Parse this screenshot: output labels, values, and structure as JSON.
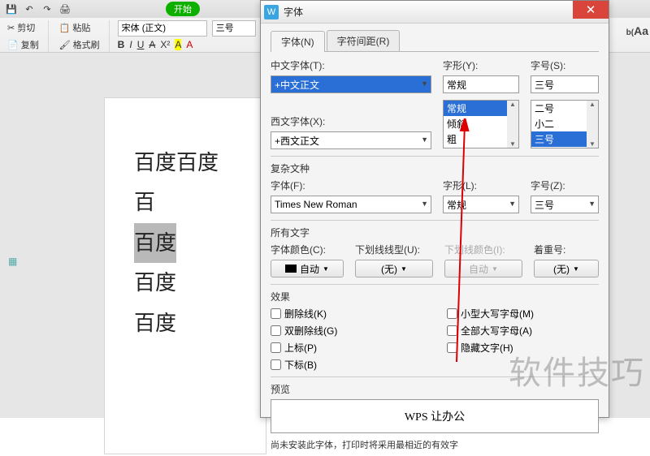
{
  "ribbon": {
    "cut_label": "剪切",
    "copy_label": "复制",
    "paste_label": "粘贴",
    "format_painter_label": "格式刷",
    "font_name": "宋体 (正文)",
    "font_size": "三号",
    "start_tab": "开始"
  },
  "document": {
    "line1": "百度百度百",
    "line2_highlighted": "百度",
    "line3": "百度",
    "line4": "百度"
  },
  "dialog": {
    "title": "字体",
    "app_icon_text": "W",
    "tabs": {
      "font": "字体(N)",
      "spacing": "字符间距(R)"
    },
    "labels": {
      "chinese_font": "中文字体(T):",
      "style": "字形(Y):",
      "size": "字号(S):",
      "western_font": "西文字体(X):",
      "complex_section": "复杂文种",
      "font": "字体(F):",
      "style2": "字形(L):",
      "size2": "字号(Z):",
      "all_text_section": "所有文字",
      "font_color": "字体颜色(C):",
      "underline_style": "下划线线型(U):",
      "underline_color": "下划线颜色(I):",
      "emphasis": "着重号:",
      "effects_section": "效果",
      "preview_section": "预览"
    },
    "values": {
      "chinese_font": "+中文正文",
      "style": "常规",
      "size": "三号",
      "western_font": "+西文正文",
      "complex_font": "Times New Roman",
      "complex_style": "常规",
      "complex_size": "三号",
      "font_color": "自动",
      "underline_style": "(无)",
      "underline_color": "自动",
      "emphasis": "(无)"
    },
    "style_options": [
      "常规",
      "倾斜",
      "粗"
    ],
    "size_options": [
      "二号",
      "小二",
      "三号"
    ],
    "effects": {
      "strikethrough": "删除线(K)",
      "double_strike": "双删除线(G)",
      "superscript": "上标(P)",
      "subscript": "下标(B)",
      "small_caps": "小型大写字母(M)",
      "all_caps": "全部大写字母(A)",
      "hidden": "隐藏文字(H)"
    },
    "preview_text": "WPS 让办公",
    "hint": "尚未安装此字体，打印时将采用最相近的有效字"
  },
  "watermark": "软件技巧",
  "aa_badge": "Aa"
}
